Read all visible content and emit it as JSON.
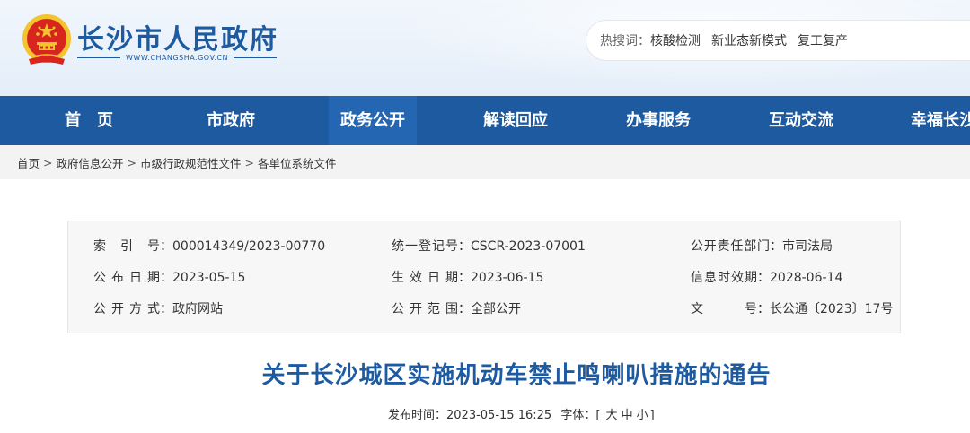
{
  "site": {
    "name": "长沙市人民政府",
    "domain": "WWW.CHANGSHA.GOV.CN"
  },
  "search": {
    "hot_label": "热搜词：",
    "hot_words": [
      "核酸检测",
      "新业态新模式",
      "复工复产"
    ]
  },
  "nav": {
    "items": [
      "首　页",
      "市政府",
      "政务公开",
      "解读回应",
      "办事服务",
      "互动交流",
      "幸福长沙"
    ],
    "active_index": 2
  },
  "breadcrumb": {
    "items": [
      "首页",
      "政府信息公开",
      "市级行政规范性文件",
      "各单位系统文件"
    ],
    "separator": ">"
  },
  "meta": {
    "rows": [
      [
        {
          "label": "索 引 号",
          "value": "000014349/2023-00770"
        },
        {
          "label": "统一登记号",
          "value": "CSCR-2023-07001"
        },
        {
          "label": "公开责任部门",
          "value": "市司法局"
        }
      ],
      [
        {
          "label": "公布日期",
          "value": "2023-05-15"
        },
        {
          "label": "生 效 日 期",
          "value": "2023-06-15"
        },
        {
          "label": "信息时效期",
          "value": "2028-06-14"
        }
      ],
      [
        {
          "label": "公开方式",
          "value": "政府网站"
        },
        {
          "label": "公 开 范 围",
          "value": "全部公开"
        },
        {
          "label": "文　　号",
          "value": "长公通〔2023〕17号"
        }
      ]
    ]
  },
  "document": {
    "title": "关于长沙城区实施机动车禁止鸣喇叭措施的通告",
    "published_label": "发布时间：",
    "published": "2023-05-15 16:25",
    "font_label": "字体：",
    "font_open": "[",
    "font_sizes": [
      "大",
      "中",
      "小"
    ],
    "font_close": "]"
  },
  "colors": {
    "brand_blue": "#1d5aa0",
    "emblem_red": "#d7261e",
    "emblem_gold": "#f4c430"
  },
  "icons": {
    "emblem": "national-emblem-icon"
  }
}
